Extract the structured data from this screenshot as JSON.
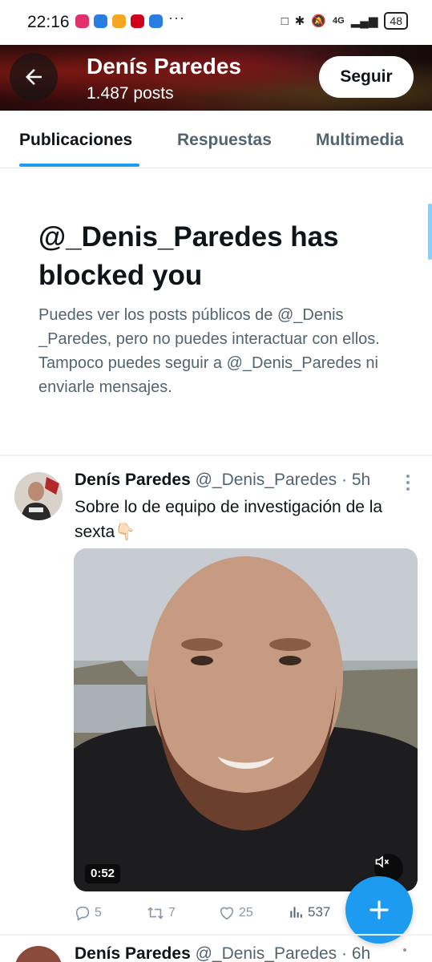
{
  "status_bar": {
    "time": "22:16",
    "more": "···",
    "network": "4G",
    "battery": "48",
    "app_colors": [
      "#e1306c",
      "#2a7de1",
      "#f5a623",
      "#d0021b",
      "#2a7de1"
    ]
  },
  "header": {
    "name": "Denís Paredes",
    "posts": "1.487 posts",
    "follow_label": "Seguir"
  },
  "tabs": [
    {
      "label": "Publicaciones",
      "active": true
    },
    {
      "label": "Respuestas",
      "active": false
    },
    {
      "label": "Multimedia",
      "active": false
    }
  ],
  "blocked": {
    "title": "@_Denis_Paredes has blocked you",
    "text": "Puedes ver los posts públicos de @_Denis _Paredes, pero no puedes interactuar con ellos. Tampoco puedes seguir a @_Denis_Paredes ni enviarle mensajes."
  },
  "tweet": {
    "name": "Denís Paredes",
    "handle_time": "@_Denis_Paredes · 5h",
    "text": "Sobre lo de equipo de investigación de la sexta👇🏻",
    "video_duration": "0:52",
    "replies": "5",
    "retweets": "7",
    "likes": "25",
    "views": "537"
  },
  "tweet2": {
    "name": "Denís Paredes",
    "handle_time": "@_Denis_Paredes · 6h"
  },
  "colors": {
    "accent": "#1d9bf0",
    "secondary_text": "#536471"
  }
}
